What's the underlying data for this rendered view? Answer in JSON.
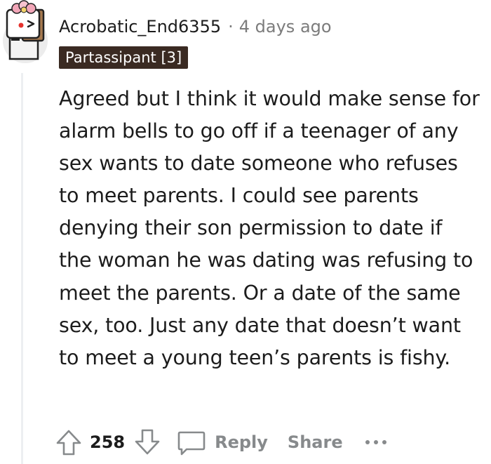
{
  "comment": {
    "username": "Acrobatic_End6355",
    "separator": "·",
    "timestamp": "4 days ago",
    "flair": "Partassipant [3]",
    "body": "Agreed but I think it would make sense for alarm bells to go off if a teenager of any sex wants to date someone who refuses to meet parents. I could see parents denying their son permission to date if the woman he was dating was refusing to meet the parents. Or a date of the same sex, too. Just any date that doesn’t want to meet a young teen’s parents is fishy."
  },
  "actions": {
    "upvote_icon": "arrow-up-icon",
    "score": "258",
    "downvote_icon": "arrow-down-icon",
    "reply_icon": "speech-bubble-icon",
    "reply_label": "Reply",
    "share_label": "Share",
    "more_icon": "ellipsis-icon"
  },
  "colors": {
    "flair_bg": "#3a2a22",
    "meta_gray": "#7c7c7c",
    "action_gray": "#878a8c",
    "thread_line": "#edeff1"
  }
}
